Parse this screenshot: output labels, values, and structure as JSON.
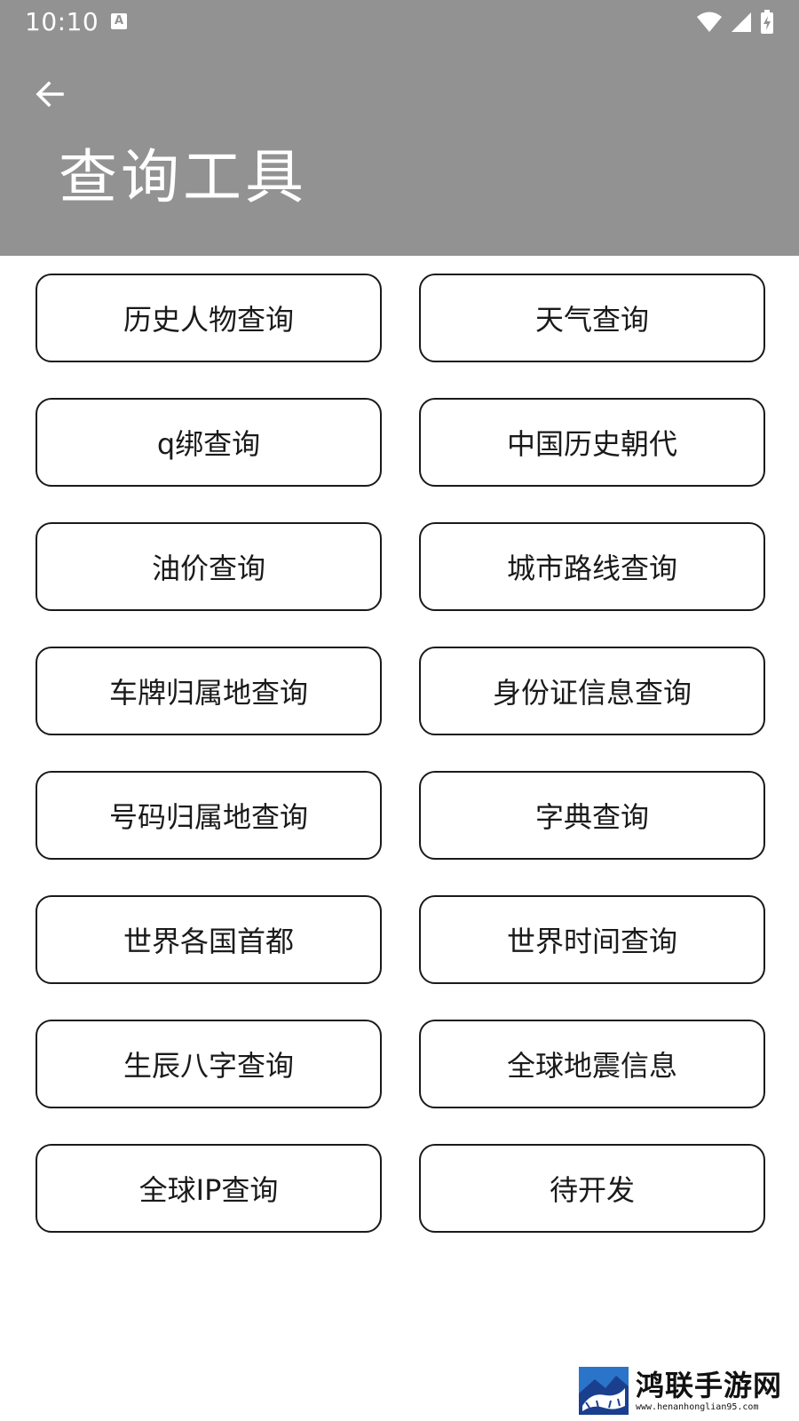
{
  "status_bar": {
    "time": "10:10",
    "notification_icon_letter": "A",
    "icons": [
      "wifi-icon",
      "signal-icon",
      "battery-charging-icon"
    ]
  },
  "app_bar": {
    "back_icon": "arrow-left-icon",
    "title": "查询工具",
    "background_color": "#929292"
  },
  "tools": [
    {
      "label": "历史人物查询"
    },
    {
      "label": "天气查询"
    },
    {
      "label": "q绑查询"
    },
    {
      "label": "中国历史朝代"
    },
    {
      "label": "油价查询"
    },
    {
      "label": "城市路线查询"
    },
    {
      "label": "车牌归属地查询"
    },
    {
      "label": "身份证信息查询"
    },
    {
      "label": "号码归属地查询"
    },
    {
      "label": "字典查询"
    },
    {
      "label": "世界各国首都"
    },
    {
      "label": "世界时间查询"
    },
    {
      "label": "生辰八字查询"
    },
    {
      "label": "全球地震信息"
    },
    {
      "label": "全球IP查询"
    },
    {
      "label": "待开发"
    }
  ],
  "watermark": {
    "name": "鸿联手游网",
    "url": "www.henanhonglian95.com"
  }
}
